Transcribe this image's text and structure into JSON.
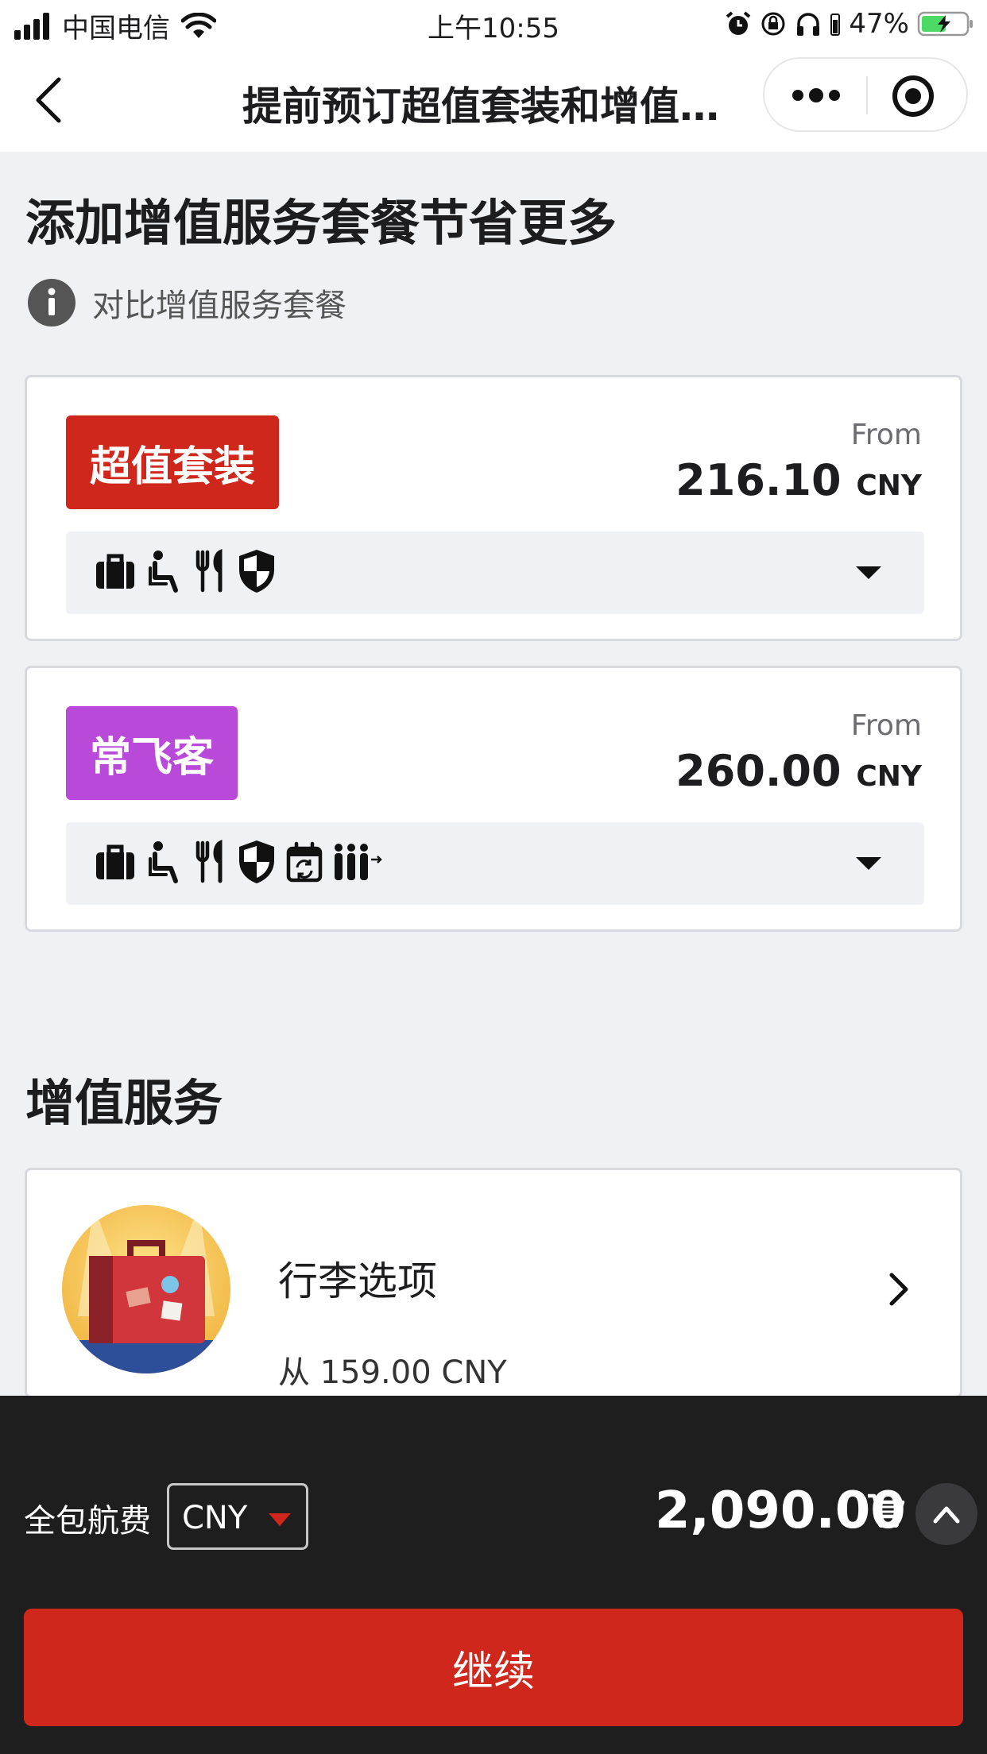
{
  "status_bar": {
    "carrier": "中国电信",
    "time": "上午10:55",
    "battery_percent": "47%"
  },
  "nav": {
    "title": "提前预订超值套装和增值…",
    "more_icon": "more-dots-icon",
    "target_icon": "target-icon"
  },
  "bundles_section": {
    "title": "添加增值服务套餐节省更多",
    "compare_link": "对比增值服务套餐",
    "bundles": [
      {
        "badge": "超值套装",
        "badge_color": "#d0271d",
        "from_label": "From",
        "price": "216.10",
        "currency": "CNY",
        "icons": [
          "baggage-icon",
          "seat-icon",
          "meal-icon",
          "insurance-shield-icon"
        ]
      },
      {
        "badge": "常飞客",
        "badge_color": "#b94ad9",
        "from_label": "From",
        "price": "260.00",
        "currency": "CNY",
        "icons": [
          "baggage-icon",
          "seat-icon",
          "meal-icon",
          "insurance-shield-icon",
          "flexible-date-icon",
          "priority-queue-icon"
        ]
      }
    ]
  },
  "ancillaries_section": {
    "title": "增值服务",
    "items": [
      {
        "name": "行李选项",
        "price": "从 159.00 CNY"
      }
    ]
  },
  "bottom_bar": {
    "fare_label": "全包航费",
    "currency": "CNY",
    "total": "2,090.00",
    "continue_label": "继续",
    "accent_color": "#d0271d"
  }
}
